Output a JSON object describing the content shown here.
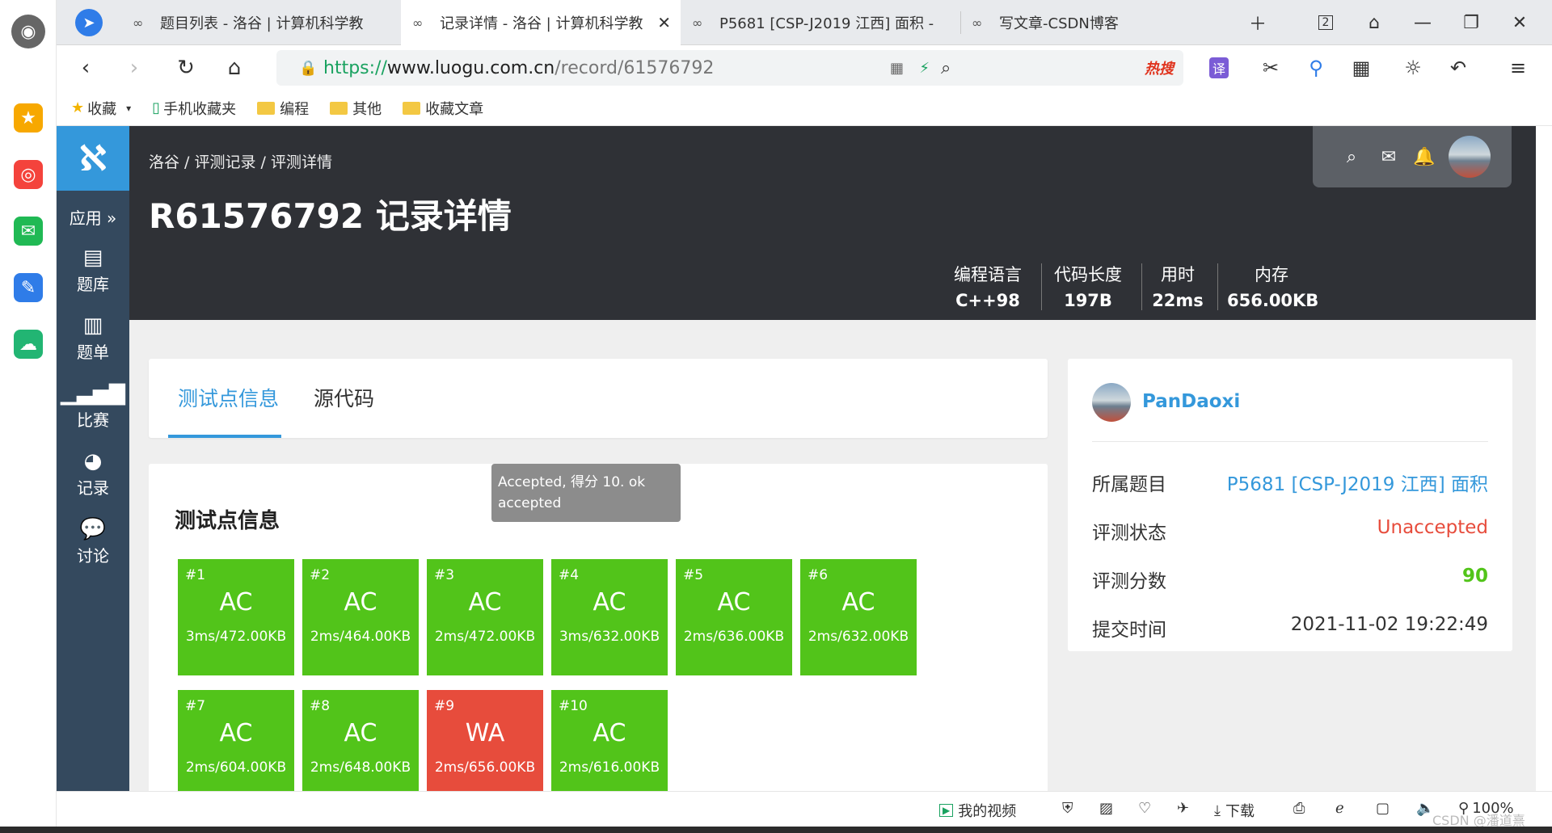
{
  "browser": {
    "tabs": [
      {
        "title": "题目列表 - 洛谷 | 计算机科学教",
        "active": false
      },
      {
        "title": "记录详情 - 洛谷 | 计算机科学教",
        "active": true
      },
      {
        "title": "P5681 [CSP-J2019 江西] 面积 -",
        "active": false
      },
      {
        "title": "写文章-CSDN博客",
        "active": false
      }
    ],
    "tab_count": "2",
    "url": {
      "proto": "https://",
      "host": "www.luogu.com.cn",
      "path": "/record/61576792"
    },
    "hot_search": "热搜",
    "translate_label": "译",
    "bookmarks": [
      "收藏",
      "手机收藏夹",
      "编程",
      "其他",
      "收藏文章"
    ]
  },
  "site": {
    "apps_label": "应用 »",
    "nav": [
      "题库",
      "题单",
      "比赛",
      "记录",
      "讨论"
    ],
    "breadcrumb": "洛谷 / 评测记录 / 评测详情",
    "title": "R61576792 记录详情",
    "stats": [
      {
        "label": "编程语言",
        "value": "C++98"
      },
      {
        "label": "代码长度",
        "value": "197B"
      },
      {
        "label": "用时",
        "value": "22ms"
      },
      {
        "label": "内存",
        "value": "656.00KB"
      }
    ],
    "tabs": [
      "测试点信息",
      "源代码"
    ],
    "testcase_heading": "测试点信息",
    "tooltip": "Accepted, 得分 10. ok accepted",
    "testcases": [
      {
        "id": "#1",
        "status": "AC",
        "info": "3ms/472.00KB"
      },
      {
        "id": "#2",
        "status": "AC",
        "info": "2ms/464.00KB"
      },
      {
        "id": "#3",
        "status": "AC",
        "info": "2ms/472.00KB"
      },
      {
        "id": "#4",
        "status": "AC",
        "info": "3ms/632.00KB"
      },
      {
        "id": "#5",
        "status": "AC",
        "info": "2ms/636.00KB"
      },
      {
        "id": "#6",
        "status": "AC",
        "info": "2ms/632.00KB"
      },
      {
        "id": "#7",
        "status": "AC",
        "info": "2ms/604.00KB"
      },
      {
        "id": "#8",
        "status": "AC",
        "info": "2ms/648.00KB"
      },
      {
        "id": "#9",
        "status": "WA",
        "info": "2ms/656.00KB"
      },
      {
        "id": "#10",
        "status": "AC",
        "info": "2ms/616.00KB"
      }
    ],
    "info": {
      "username": "PanDaoxi",
      "problem_label": "所属题目",
      "problem_value": "P5681 [CSP-J2019 江西] 面积",
      "status_label": "评测状态",
      "status_value": "Unaccepted",
      "score_label": "评测分数",
      "score_value": "90",
      "time_label": "提交时间",
      "time_value": "2021-11-02 19:22:49"
    },
    "colors": {
      "ac": "#52c41a",
      "wa": "#e74c3c",
      "link": "#3498db",
      "unaccepted": "#e74c3c",
      "score": "#52c41a"
    }
  },
  "statusbar": {
    "my_video": "我的视频",
    "download": "下载",
    "zoom": "100%",
    "watermark": "CSDN @潘道熹"
  }
}
